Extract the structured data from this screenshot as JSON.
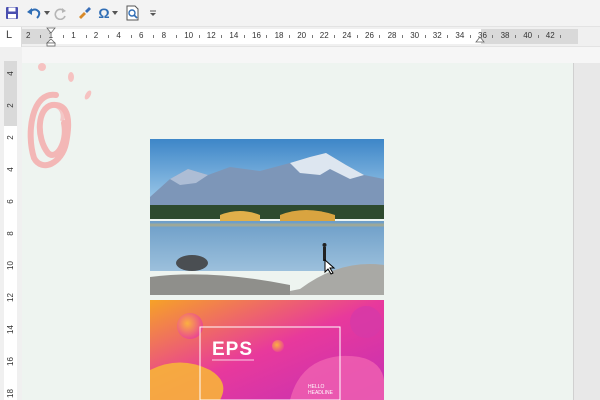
{
  "toolbar": {
    "buttons": [
      "save",
      "undo",
      "undo-dropdown",
      "redo",
      "format-painter",
      "symbol",
      "symbol-dropdown",
      "print-preview",
      "customize"
    ],
    "symbol_glyph": "Ω"
  },
  "ruler": {
    "corner_label": "L",
    "labels": [
      "2",
      "1",
      "1",
      "2",
      "4",
      "6",
      "8",
      "10",
      "12",
      "14",
      "16",
      "18",
      "20",
      "22",
      "24",
      "26",
      "28",
      "30",
      "32",
      "34",
      "36",
      "38",
      "40",
      "42"
    ],
    "vertical_labels": [
      "4",
      "2",
      "2",
      "4",
      "6",
      "8",
      "10",
      "12",
      "14",
      "16",
      "18"
    ]
  },
  "document": {
    "image1": "mountain-lake-photo",
    "image2": {
      "title": "EPS",
      "hello_line1": "HELLO",
      "hello_line2": "HEADLINE"
    }
  },
  "colors": {
    "toolbar_bg": "#f3f3f3",
    "page_bg": "#eef4f0",
    "accent_blue": "#2f6db5"
  }
}
